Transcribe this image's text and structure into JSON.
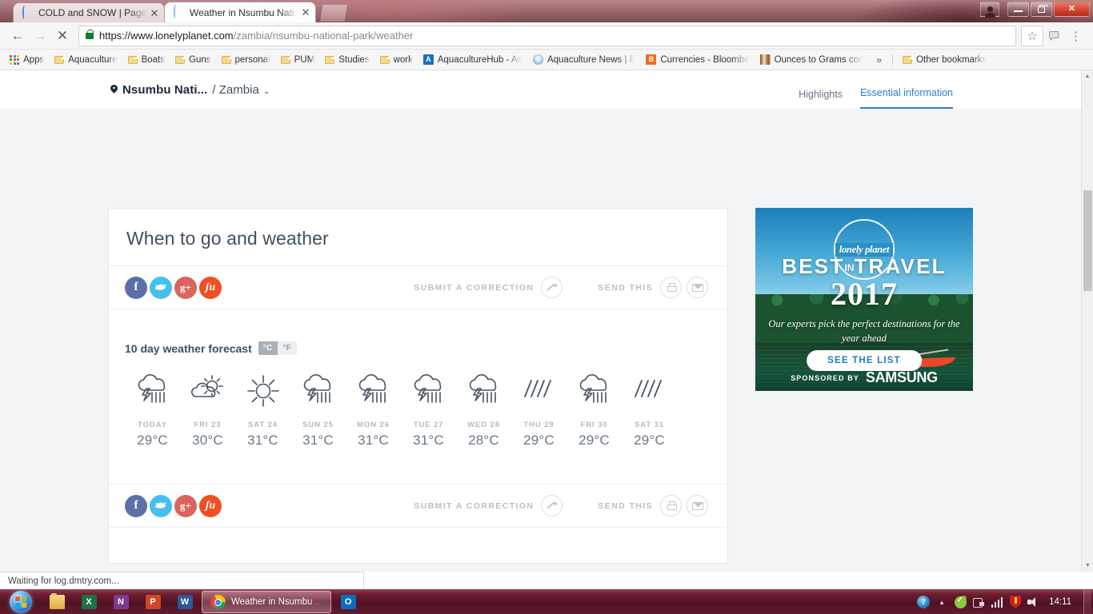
{
  "browser": {
    "tabs": [
      {
        "title": "COLD and SNOW | Page",
        "favicon": "loading-spinner-icon",
        "active": false,
        "close_label": "✕"
      },
      {
        "title": "Weather in Nsumbu Nati",
        "favicon": "loading-spinner-icon",
        "active": true,
        "close_label": "✕"
      }
    ],
    "nav": {
      "back_label": "←",
      "forward_label": "→",
      "stop_label": "✕"
    },
    "url": {
      "domain": "https://www.lonelyplanet.com",
      "path": "/zambia/nsumbu-national-park/weather",
      "lock_icon": "lock-icon"
    },
    "toolbar_icons": {
      "star": "☆",
      "cast": "translate-icon",
      "menu": "⋮"
    },
    "window_controls": {
      "profile": "person-icon",
      "minimize": "—",
      "maximize": "❐",
      "close": "✕"
    }
  },
  "bookmarks": {
    "apps_label": "Apps",
    "items": [
      {
        "label": "Aquaculture",
        "icon": "folder-icon"
      },
      {
        "label": "Boats",
        "icon": "folder-icon"
      },
      {
        "label": "Guns",
        "icon": "folder-icon"
      },
      {
        "label": "personal",
        "icon": "folder-icon"
      },
      {
        "label": "PUM",
        "icon": "folder-icon"
      },
      {
        "label": "Studies",
        "icon": "folder-icon"
      },
      {
        "label": "work",
        "icon": "folder-icon"
      },
      {
        "label": "AquacultureHub - An",
        "icon": "aquaculturehub-favicon",
        "favicon_text": "A"
      },
      {
        "label": "Aquaculture News | B",
        "icon": "news-favicon",
        "favicon_text": ""
      },
      {
        "label": "Currencies - Bloombe",
        "icon": "bloomberg-favicon",
        "favicon_text": "B"
      },
      {
        "label": "Ounces to Grams con",
        "icon": "ruler-favicon",
        "favicon_text": ""
      }
    ],
    "overflow_label": "»",
    "other_bookmarks_label": "Other bookmarks"
  },
  "page": {
    "breadcrumb": {
      "place": "Nsumbu Nati...",
      "separator": "/",
      "country": "Zambia",
      "chevron": "⌄"
    },
    "header_tabs": [
      {
        "label": "Highlights",
        "active": false
      },
      {
        "label": "Essential information",
        "active": true
      }
    ],
    "card_title": "When to go and weather",
    "share": {
      "social": [
        {
          "name": "facebook",
          "glyph": "f"
        },
        {
          "name": "twitter",
          "glyph": ""
        },
        {
          "name": "googleplus",
          "glyph": "g+"
        },
        {
          "name": "stumbleupon",
          "glyph": "su"
        }
      ],
      "correction_label": "SUBMIT A CORRECTION",
      "correction_icon": "pencil-icon",
      "send_label": "SEND THIS",
      "print_icon": "printer-icon",
      "email_icon": "envelope-icon"
    },
    "forecast": {
      "title": "10 day weather forecast",
      "units": [
        {
          "label": "°C",
          "selected": true
        },
        {
          "label": "°F",
          "selected": false
        }
      ]
    },
    "advert": {
      "logo_text": "lonely planet",
      "headline_a": "BEST",
      "headline_in": "IN",
      "headline_b": "TRAVEL",
      "year": "2017",
      "subtitle": "Our experts pick the perfect destinations for the year ahead",
      "cta": "SEE THE LIST",
      "sponsor_label": "SPONSORED BY",
      "sponsor_brand": "SAMSUNG"
    },
    "status_text": "Waiting for log.dmtry.com..."
  },
  "chart_data": {
    "type": "table",
    "title": "10 day weather forecast",
    "unit": "°C",
    "categories": [
      "TODAY",
      "FRI 23",
      "SAT 24",
      "SUN 25",
      "MON 26",
      "TUE 27",
      "WED 28",
      "THU 29",
      "FRI 30",
      "SAT 31"
    ],
    "values": [
      29,
      30,
      31,
      31,
      31,
      31,
      28,
      29,
      29,
      29
    ],
    "labels": [
      "29°C",
      "30°C",
      "31°C",
      "31°C",
      "31°C",
      "31°C",
      "28°C",
      "29°C",
      "29°C",
      "29°C"
    ],
    "conditions": [
      "thunderstorm",
      "partly-cloudy",
      "sunny",
      "thunderstorm",
      "thunderstorm",
      "thunderstorm",
      "thunderstorm",
      "rain",
      "thunderstorm",
      "rain"
    ],
    "days": [
      {
        "day": "TODAY",
        "temp": "29°C",
        "condition": "thunderstorm"
      },
      {
        "day": "FRI 23",
        "temp": "30°C",
        "condition": "partly-cloudy"
      },
      {
        "day": "SAT 24",
        "temp": "31°C",
        "condition": "sunny"
      },
      {
        "day": "SUN 25",
        "temp": "31°C",
        "condition": "thunderstorm"
      },
      {
        "day": "MON 26",
        "temp": "31°C",
        "condition": "thunderstorm"
      },
      {
        "day": "TUE 27",
        "temp": "31°C",
        "condition": "thunderstorm"
      },
      {
        "day": "WED 28",
        "temp": "28°C",
        "condition": "thunderstorm"
      },
      {
        "day": "THU 29",
        "temp": "29°C",
        "condition": "rain"
      },
      {
        "day": "FRI 30",
        "temp": "29°C",
        "condition": "thunderstorm"
      },
      {
        "day": "SAT 31",
        "temp": "29°C",
        "condition": "rain"
      }
    ]
  },
  "taskbar": {
    "start_label": "Start",
    "items": [
      {
        "name": "explorer",
        "label": ""
      },
      {
        "name": "excel",
        "label": "X"
      },
      {
        "name": "onenote",
        "label": "N"
      },
      {
        "name": "powerpoint",
        "label": "P"
      },
      {
        "name": "word",
        "label": "W"
      }
    ],
    "active_window": {
      "label": "Weather in Nsumbu ...",
      "icon": "chrome-icon"
    },
    "outlook_label": "O",
    "tray": {
      "help": "?",
      "chevron": "▲",
      "clock": "14:11"
    }
  },
  "colors": {
    "accent_blue": "#2b7fd4",
    "facebook": "#5d6fa8",
    "twitter": "#45c0ee",
    "googleplus": "#d9655c",
    "stumbleupon": "#f04f23",
    "heading": "#41505f",
    "muted": "#b3bac1"
  }
}
